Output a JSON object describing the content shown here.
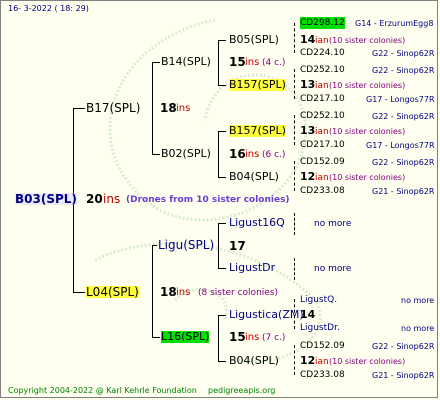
{
  "header": {
    "date": "16-  3-2022 ( 18: 29)"
  },
  "footer": {
    "copyright": "Copyright 2004-2022 @ Karl Kehrle Foundation",
    "site": "pedigreeapis.org"
  },
  "root": {
    "name": "B03(SPL)",
    "num": "20",
    "ins": "ins",
    "note": "(Drones from 10 sister colonies)"
  },
  "b17": {
    "name": "B17(SPL)",
    "num": "18",
    "ins": "ins"
  },
  "b14": {
    "name": "B14(SPL)",
    "num": "15",
    "ins": "ins",
    "note": "(4 c.)"
  },
  "b05": {
    "name": "B05(SPL)",
    "num": "14",
    "ins": "ian",
    "note": "(10 sister colonies)"
  },
  "b05_top": {
    "code": "CD298.12",
    "info": "G14 - ErzurumEgg8"
  },
  "b05_bot": {
    "code": "CD224.10",
    "info": "G22 - Sinop62R"
  },
  "b157a": {
    "name": "B157(SPL)",
    "num": "13",
    "ins": "ian",
    "note": "(10 sister colonies)"
  },
  "b157a_top": {
    "code": "CD252.10",
    "info": "G22 - Sinop62R"
  },
  "b157a_bot": {
    "code": "CD217.10",
    "info": "G17 - Longos77R"
  },
  "b02": {
    "name": "B02(SPL)",
    "num": "16",
    "ins": "ins",
    "note": "(6 c.)"
  },
  "b157b": {
    "name": "B157(SPL)",
    "num": "13",
    "ins": "ian",
    "note": "(10 sister colonies)"
  },
  "b157b_top": {
    "code": "CD252.10",
    "info": "G22 - Sinop62R"
  },
  "b157b_bot": {
    "code": "CD217.10",
    "info": "G17 - Longos77R"
  },
  "b04a": {
    "name": "B04(SPL)",
    "num": "12",
    "ins": "ian",
    "note": "(10 sister colonies)"
  },
  "b04a_top": {
    "code": "CD152.09",
    "info": "G22 - Sinop62R"
  },
  "b04a_bot": {
    "code": "CD233.08",
    "info": "G21 - Sinop62R"
  },
  "l04": {
    "name": "L04(SPL)",
    "num": "18",
    "ins": "ins",
    "note": "(8 sister colonies)"
  },
  "ligu": {
    "name": "Ligu(SPL)",
    "num": "17"
  },
  "ligust16q": {
    "name": "Ligust16Q",
    "more": "no more"
  },
  "ligustdr": {
    "name": "LigustDr",
    "more": "no more"
  },
  "l16": {
    "name": "L16(SPL)",
    "num": "15",
    "ins": "ins",
    "note": "(7 c.)"
  },
  "ligustica": {
    "name": "Ligustica(ZM)",
    "num": "14"
  },
  "ligustica_top": {
    "code": "LigustQ.",
    "more": "no more"
  },
  "ligustica_bot": {
    "code": "LigustDr.",
    "more": "no more"
  },
  "b04b": {
    "name": "B04(SPL)",
    "num": "12",
    "ins": "ian",
    "note": "(10 sister colonies)"
  },
  "b04b_top": {
    "code": "CD152.09",
    "info": "G22 - Sinop62R"
  },
  "b04b_bot": {
    "code": "CD233.08",
    "info": "G21 - Sinop62R"
  }
}
